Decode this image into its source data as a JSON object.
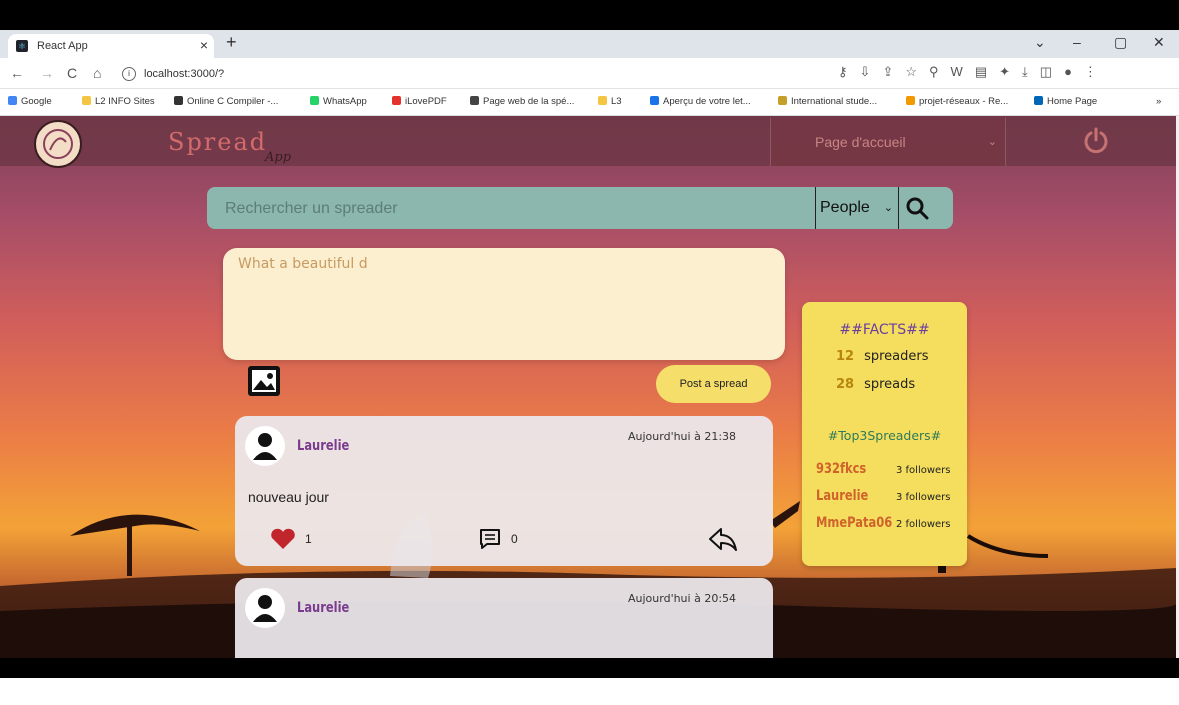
{
  "browser": {
    "tab_title": "React App",
    "tab_close": "×",
    "new_tab": "+",
    "url": "localhost:3000/?",
    "window_controls": [
      "⌄",
      "–",
      "▢",
      "✕"
    ],
    "bookmarks": [
      {
        "label": "Google",
        "color": "#4285f4"
      },
      {
        "label": "L2 INFO Sites",
        "color": "#f4c542"
      },
      {
        "label": "Online C Compiler -...",
        "color": "#333333"
      },
      {
        "label": "WhatsApp",
        "color": "#25d366"
      },
      {
        "label": "iLovePDF",
        "color": "#e5322d"
      },
      {
        "label": "Page web de la spé...",
        "color": "#444444"
      },
      {
        "label": "L3",
        "color": "#f4c542"
      },
      {
        "label": "Aperçu de votre let...",
        "color": "#1a73e8"
      },
      {
        "label": "International stude...",
        "color": "#c5a028"
      },
      {
        "label": "projet-réseaux - Re...",
        "color": "#f29900"
      },
      {
        "label": "Home Page",
        "color": "#0067b8"
      }
    ],
    "more_bookmarks": "»"
  },
  "app": {
    "brand": "Spread",
    "brand_sub": "App",
    "nav_select_value": "Page d'accueil",
    "search_placeholder": "Rechercher un spreader",
    "search_type": "People",
    "composer_text": "What a beautiful d",
    "post_button": "Post a spread",
    "posts": [
      {
        "user": "Laurelie",
        "date": "Aujourd'hui à 21:38",
        "text": "nouveau jour",
        "likes": "1",
        "comments": "0"
      },
      {
        "user": "Laurelie",
        "date": "Aujourd'hui à 20:54"
      }
    ],
    "facts": {
      "title": "##FACTS##",
      "spreaders_count": "12",
      "spreaders_label": "spreaders",
      "spreads_count": "28",
      "spreads_label": "spreads",
      "top_title": "#Top3Spreaders#",
      "top": [
        {
          "name": "932fkcs",
          "followers": "3 followers"
        },
        {
          "name": "Laurelie",
          "followers": "3 followers"
        },
        {
          "name": "MmePata06",
          "followers": "2 followers"
        }
      ]
    }
  },
  "colors": {
    "accent_purple": "#7a3a8e",
    "facts_bg": "#f5de5e",
    "search_bg": "#8bb7ae",
    "like_heart": "#c0262b"
  },
  "icons": [
    "react-favicon",
    "back-arrow",
    "forward-arrow",
    "reload",
    "home",
    "info",
    "key",
    "install",
    "share",
    "star",
    "search",
    "extensions",
    "download",
    "sidebar",
    "profile",
    "menu",
    "power",
    "search",
    "image",
    "heart",
    "comment",
    "share-reply"
  ]
}
